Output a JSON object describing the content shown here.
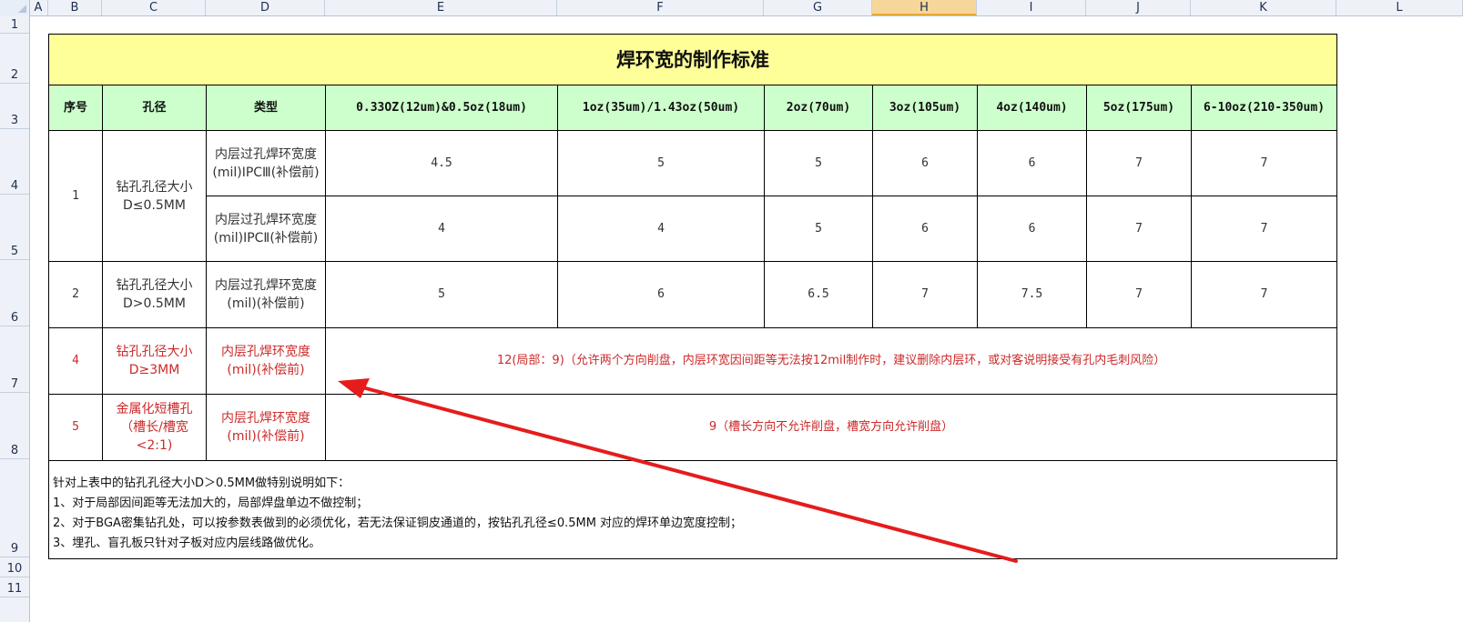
{
  "columns": [
    "A",
    "B",
    "C",
    "D",
    "E",
    "F",
    "G",
    "H",
    "I",
    "J",
    "K",
    "L"
  ],
  "rows": [
    "1",
    "2",
    "3",
    "4",
    "5",
    "6",
    "7",
    "8",
    "9",
    "10",
    "11"
  ],
  "active_column": "H",
  "table": {
    "title": "焊环宽的制作标准",
    "headers": [
      "序号",
      "孔径",
      "类型",
      "0.33OZ(12um)&0.5oz(18um)",
      "1oz(35um)/1.43oz(50um)",
      "2oz(70um)",
      "3oz(105um)",
      "4oz(140um)",
      "5oz(175um)",
      "6-10oz(210-350um)"
    ],
    "group1": {
      "no": "1",
      "size": "钻孔孔径大小D≤0.5MM",
      "rows": [
        {
          "type": "内层过孔焊环宽度(mil)IPCⅢ(补偿前)",
          "values": [
            "4.5",
            "5",
            "5",
            "6",
            "6",
            "7",
            "7"
          ]
        },
        {
          "type": "内层过孔焊环宽度(mil)IPCⅡ(补偿前)",
          "values": [
            "4",
            "4",
            "5",
            "6",
            "6",
            "7",
            "7"
          ]
        }
      ]
    },
    "group2": {
      "no": "2",
      "size": "钻孔孔径大小D>0.5MM",
      "type": "内层过孔焊环宽度(mil)(补偿前)",
      "values": [
        "5",
        "6",
        "6.5",
        "7",
        "7.5",
        "7",
        "7"
      ]
    },
    "group4": {
      "no": "4",
      "size": "钻孔孔径大小D≥3MM",
      "type": "内层孔焊环宽度(mil)(补偿前)",
      "value": "12(局部：9)（允许两个方向削盘，内层环宽因间距等无法按12mil制作时，建议删除内层环，或对客说明接受有孔内毛刺风险）"
    },
    "group5": {
      "no": "5",
      "size": "金属化短槽孔（槽长/槽宽<2:1)",
      "type": "内层孔焊环宽度(mil)(补偿前)",
      "value": "9（槽长方向不允许削盘，槽宽方向允许削盘）"
    },
    "notes": [
      "针对上表中的钻孔孔径大小D＞0.5MM做特别说明如下：",
      "1、对于局部因间距等无法加大的，局部焊盘单边不做控制；",
      "2、对于BGA密集钻孔处，可以按参数表做到的必须优化，若无法保证铜皮通道的，按钻孔孔径≤0.5MM 对应的焊环单边宽度控制；",
      "3、埋孔、盲孔板只针对子板对应内层线路做优化。"
    ]
  },
  "colors": {
    "title_fill": "#ffff99",
    "header_fill": "#ccffcc",
    "red_text": "#cc2a2a",
    "arrow": "#e51c1c"
  }
}
